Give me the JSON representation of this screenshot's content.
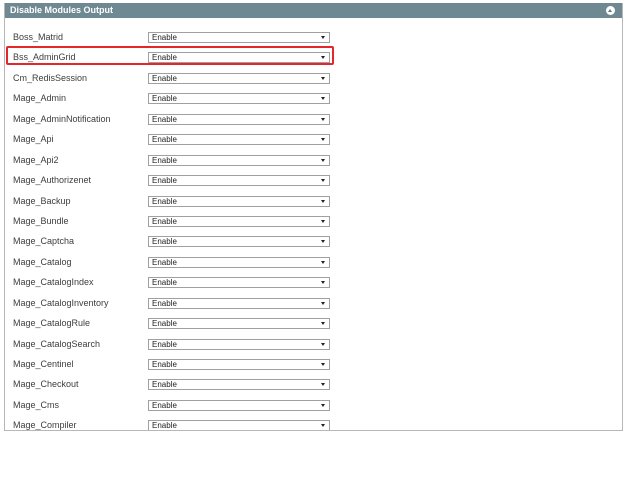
{
  "panel": {
    "title": "Disable Modules Output",
    "collapse_icon": "chevron-up-circle-icon"
  },
  "highlight": {
    "color": "#e4272a",
    "row_index": 1
  },
  "modules": [
    {
      "name": "Boss_Matrid",
      "value": "Enable"
    },
    {
      "name": "Bss_AdminGrid",
      "value": "Enable"
    },
    {
      "name": "Cm_RedisSession",
      "value": "Enable"
    },
    {
      "name": "Mage_Admin",
      "value": "Enable"
    },
    {
      "name": "Mage_AdminNotification",
      "value": "Enable"
    },
    {
      "name": "Mage_Api",
      "value": "Enable"
    },
    {
      "name": "Mage_Api2",
      "value": "Enable"
    },
    {
      "name": "Mage_Authorizenet",
      "value": "Enable"
    },
    {
      "name": "Mage_Backup",
      "value": "Enable"
    },
    {
      "name": "Mage_Bundle",
      "value": "Enable"
    },
    {
      "name": "Mage_Captcha",
      "value": "Enable"
    },
    {
      "name": "Mage_Catalog",
      "value": "Enable"
    },
    {
      "name": "Mage_CatalogIndex",
      "value": "Enable"
    },
    {
      "name": "Mage_CatalogInventory",
      "value": "Enable"
    },
    {
      "name": "Mage_CatalogRule",
      "value": "Enable"
    },
    {
      "name": "Mage_CatalogSearch",
      "value": "Enable"
    },
    {
      "name": "Mage_Centinel",
      "value": "Enable"
    },
    {
      "name": "Mage_Checkout",
      "value": "Enable"
    },
    {
      "name": "Mage_Cms",
      "value": "Enable"
    },
    {
      "name": "Mage_Compiler",
      "value": "Enable"
    }
  ]
}
